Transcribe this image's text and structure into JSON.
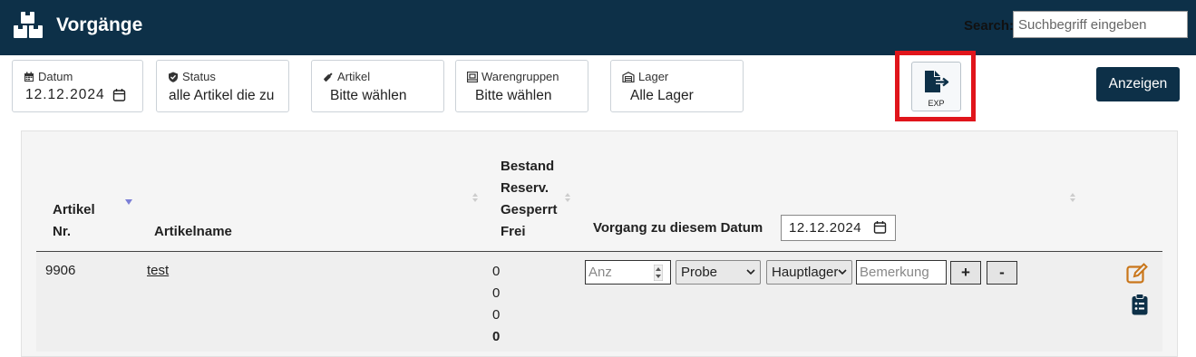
{
  "header": {
    "title": "Vorgänge",
    "logo_icon": "boxes-icon",
    "search_label": "Search:",
    "search_placeholder": "Suchbegriff eingeben"
  },
  "filters": {
    "datum": {
      "label": "Datum",
      "value": "12.12.2024",
      "icon": "calendar-icon"
    },
    "status": {
      "label": "Status",
      "value": "alle Artikel die zu",
      "icon": "shield-icon"
    },
    "artikel": {
      "label": "Artikel",
      "value": "Bitte wählen",
      "icon": "bottle-icon"
    },
    "warengruppen": {
      "label": "Warengruppen",
      "value": "Bitte wählen",
      "icon": "pallet-icon"
    },
    "lager": {
      "label": "Lager",
      "value": "Alle Lager",
      "icon": "warehouse-icon"
    }
  },
  "export_button": {
    "label": "EXP",
    "icon": "file-export-icon"
  },
  "show_button": {
    "label": "Anzeigen"
  },
  "table": {
    "columns": {
      "artikel_nr_1": "Artikel",
      "artikel_nr_2": "Nr.",
      "artikelname": "Artikelname",
      "bestand": "Bestand",
      "reserv": "Reserv.",
      "gesperrt": "Gesperrt",
      "frei": "Frei",
      "vorgang": "Vorgang zu diesem Datum",
      "vorgang_date": "12.12.2024"
    },
    "rows": [
      {
        "nr": "9906",
        "name": "test",
        "bestand": "0",
        "reserv": "0",
        "gesperrt": "0",
        "frei": "0",
        "anz_placeholder": "Anz",
        "type_select": "Probe",
        "lager_select": "Hauptlager",
        "bemerkung_placeholder": "Bemerkung",
        "plus": "+",
        "minus": "-"
      }
    ]
  },
  "colors": {
    "header_bg": "#0d3048",
    "highlight": "#e0151b",
    "edit_icon": "#c9761a",
    "sort_active": "#7b7fd6"
  }
}
